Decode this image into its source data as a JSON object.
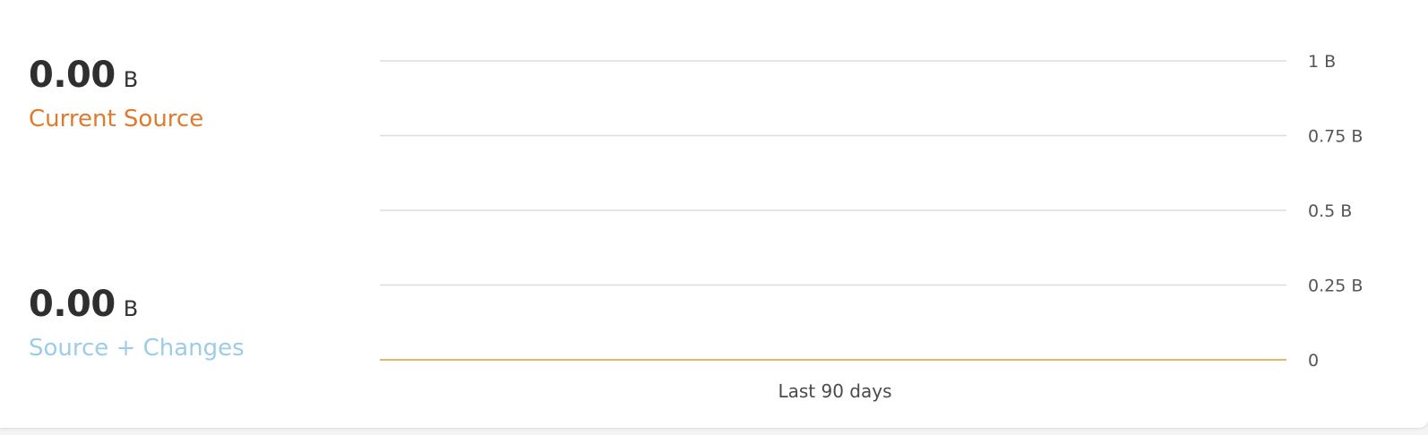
{
  "colors": {
    "current_source": "#e07a2e",
    "source_changes": "#9ccde6",
    "series_line": "#e6b566",
    "grid": "#dddddd"
  },
  "stats": [
    {
      "value": "0.00",
      "unit": "B",
      "label": "Current Source",
      "color": "#e07a2e"
    },
    {
      "value": "0.00",
      "unit": "B",
      "label": "Source + Changes",
      "color": "#9ccde6"
    }
  ],
  "chart_data": {
    "type": "line",
    "xlabel": "Last 90 days",
    "ylabel": "",
    "title": "",
    "ylim": [
      0,
      1
    ],
    "y_ticks": [
      {
        "value": 1,
        "label": "1 B"
      },
      {
        "value": 0.75,
        "label": "0.75 B"
      },
      {
        "value": 0.5,
        "label": "0.5 B"
      },
      {
        "value": 0.25,
        "label": "0.25 B"
      },
      {
        "value": 0,
        "label": "0"
      }
    ],
    "grid": true,
    "series": [
      {
        "color": "#e6b566",
        "values": [
          0,
          0
        ]
      }
    ]
  }
}
